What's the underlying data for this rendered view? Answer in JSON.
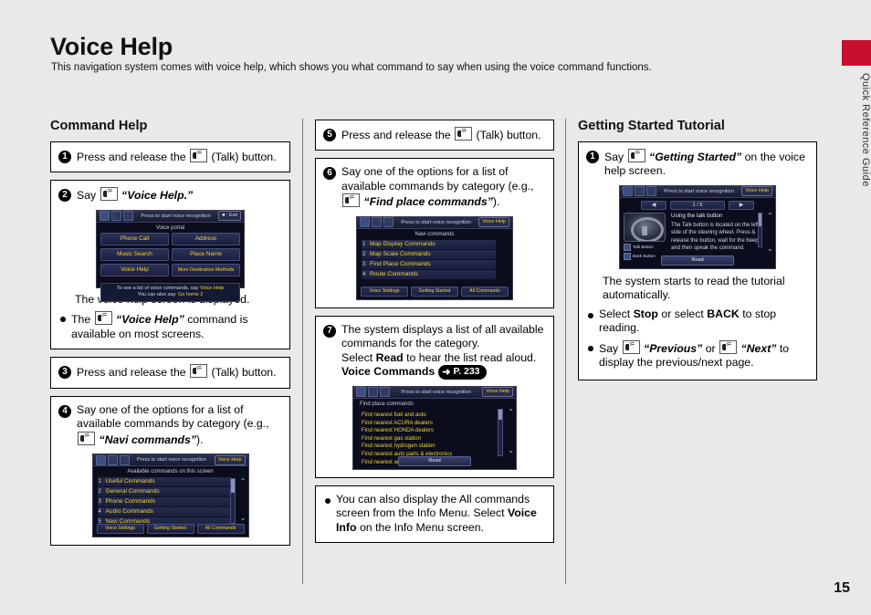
{
  "header": {
    "title": "Voice Help",
    "subtitle": "This navigation system comes with voice help, which shows you what command to say when using the voice command functions."
  },
  "side_tab": {
    "label": "Quick Reference Guide",
    "accent_color": "#c8102e"
  },
  "page_number": "15",
  "command_help": {
    "section_title": "Command Help",
    "step1": {
      "num": "1",
      "text_before": "Press and release the",
      "text_after": "(Talk) button."
    },
    "step2": {
      "num": "2",
      "text_before": "Say",
      "quote": "“Voice Help.”",
      "caption": "The voice help screen is displayed.",
      "bullet_before": "The",
      "bullet_quote": "“Voice Help”",
      "bullet_after": "command is available on most screens."
    },
    "step3": {
      "num": "3",
      "text_before": "Press and release the",
      "text_after": "(Talk) button."
    },
    "step4": {
      "num": "4",
      "text_before": "Say one of the options for a list of available commands by category (e.g.,",
      "quote": "“Navi commands”",
      "text_after": ")."
    }
  },
  "column2": {
    "step5": {
      "num": "5",
      "text_before": "Press and release the",
      "text_after": "(Talk) button."
    },
    "step6": {
      "num": "6",
      "text_before": "Say one of the options for a list of available commands by category (e.g.,",
      "quote": "“Find place commands”",
      "text_after": ")."
    },
    "step7": {
      "num": "7",
      "line1": "The system displays a list of all available commands for the category.",
      "line2_before": "Select",
      "line2_bold": "Read",
      "line2_after": "to hear the list read aloud.",
      "ref_label": "Voice Commands",
      "ref_page": "P. 233"
    },
    "note": {
      "line1": "You can also display the All commands screen from the Info Menu. Select",
      "bold": "Voice Info",
      "line2": "on the Info Menu screen."
    }
  },
  "getting_started": {
    "section_title": "Getting Started Tutorial",
    "step1": {
      "num": "1",
      "text_before": "Say",
      "quote": "“Getting Started”",
      "text_after": "on the voice help screen."
    },
    "caption": "The system starts to read the tutorial automatically.",
    "bullet1": {
      "before": "Select",
      "bold1": "Stop",
      "middle": "or select",
      "bold2": "BACK",
      "after": "to stop reading."
    },
    "bullet2": {
      "before": "Say",
      "quote1": "“Previous”",
      "middle": "or",
      "quote2": "“Next”",
      "after": "to display the previous/next page."
    }
  },
  "screens": {
    "voice_portal": {
      "topbar_text": "Press        to start voice recognition",
      "exit_pill": "■ : Exit",
      "title": "Voice portal",
      "cells": [
        [
          "Phone Call",
          "Address"
        ],
        [
          "Music Search",
          "Place Name"
        ],
        [
          "Voice Help",
          "More Destination Methods"
        ]
      ],
      "footer_line1_a": "To see a list of voice commands, say",
      "footer_line1_b": "Voice Help",
      "footer_line2_a": "You can also say:",
      "footer_line2_b": "Go home 2"
    },
    "available_commands": {
      "topbar_text": "Press        to start voice recognition",
      "help_pill": "Voice Help",
      "title": "Available commands on this screen",
      "items": [
        "Useful Commands",
        "General Commands",
        "Phone Commands",
        "Audio Commands",
        "Navi Commands"
      ],
      "tabs": [
        "Voice Settings",
        "Getting Started",
        "All Commands"
      ]
    },
    "navi_commands": {
      "topbar_text": "Press        to start voice recognition",
      "help_pill": "Voice Help",
      "title": "Navi commands",
      "items": [
        "Map Display Commands",
        "Map Scale Commands",
        "Find Place Commands",
        "Route Commands"
      ],
      "tabs": [
        "Voice Settings",
        "Getting Started",
        "All Commands"
      ]
    },
    "find_place_commands": {
      "topbar_text": "Press        to start voice recognition",
      "help_pill": "Voice Help",
      "title": "Find place commands",
      "items": [
        "Find nearest fuel and auto",
        "Find nearest ACURA dealers",
        "Find nearest HONDA dealers",
        "Find nearest gas station",
        "Find nearest hydrogen station",
        "Find nearest auto parts & electronics",
        "Find nearest auto repair & maintenance"
      ],
      "read_button": "Read"
    },
    "tutorial": {
      "topbar_text": "Press        to start voice recognition",
      "help_pill": "Voice Help",
      "prev_arrow": "◀",
      "next_arrow": "▶",
      "page_indicator": "1 / 5",
      "legend_talk": "Talk Button",
      "legend_back": "Back Button",
      "heading": "Using the talk button",
      "body": "The Talk button is located on the left side of the steering wheel. Press & release the button, wait for the beep and then speak the command.",
      "read_button": "Read"
    }
  }
}
